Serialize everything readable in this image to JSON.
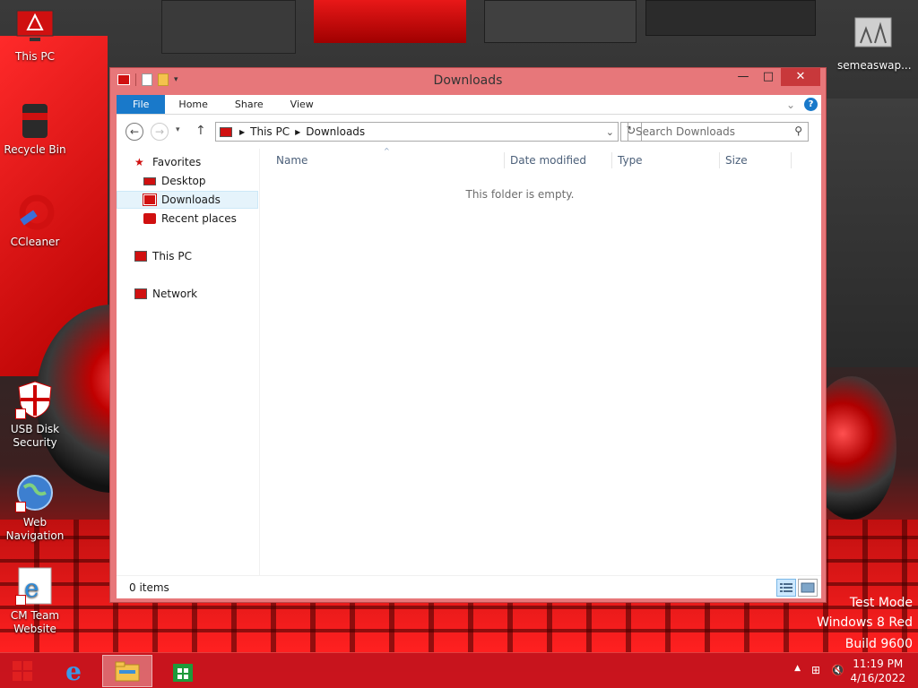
{
  "desktop": {
    "icons": [
      {
        "label": "This PC"
      },
      {
        "label": "Recycle Bin"
      },
      {
        "label": "CCleaner"
      },
      {
        "label": "USB Disk Security"
      },
      {
        "label": "Web Navigation"
      },
      {
        "label": "CM Team Website"
      },
      {
        "label": "semeaswap..."
      }
    ],
    "watermark": [
      "Test Mode",
      "Windows 8 Red",
      "Build 9600"
    ]
  },
  "window": {
    "title": "Downloads",
    "controls": {
      "minimize": "—",
      "maximize": "□",
      "close": "✕"
    },
    "ribbon": {
      "tabs": [
        "File",
        "Home",
        "Share",
        "View"
      ],
      "help": "?"
    },
    "address": {
      "crumbs": [
        "This PC",
        "Downloads"
      ]
    },
    "search": {
      "placeholder": "Search Downloads"
    },
    "nav_pane": {
      "favorites": "Favorites",
      "favorites_items": [
        "Desktop",
        "Downloads",
        "Recent places"
      ],
      "this_pc": "This PC",
      "network": "Network",
      "selected": "Downloads"
    },
    "columns": [
      "Name",
      "Date modified",
      "Type",
      "Size"
    ],
    "empty_message": "This folder is empty.",
    "status": "0 items"
  },
  "taskbar": {
    "clock": {
      "time": "11:19 PM",
      "date": "4/16/2022"
    },
    "active_app": "File Explorer"
  },
  "colors": {
    "accent": "#1979ca",
    "window_frame": "#e7777a",
    "taskbar": "#c8141e",
    "close_button": "#c8383b"
  }
}
